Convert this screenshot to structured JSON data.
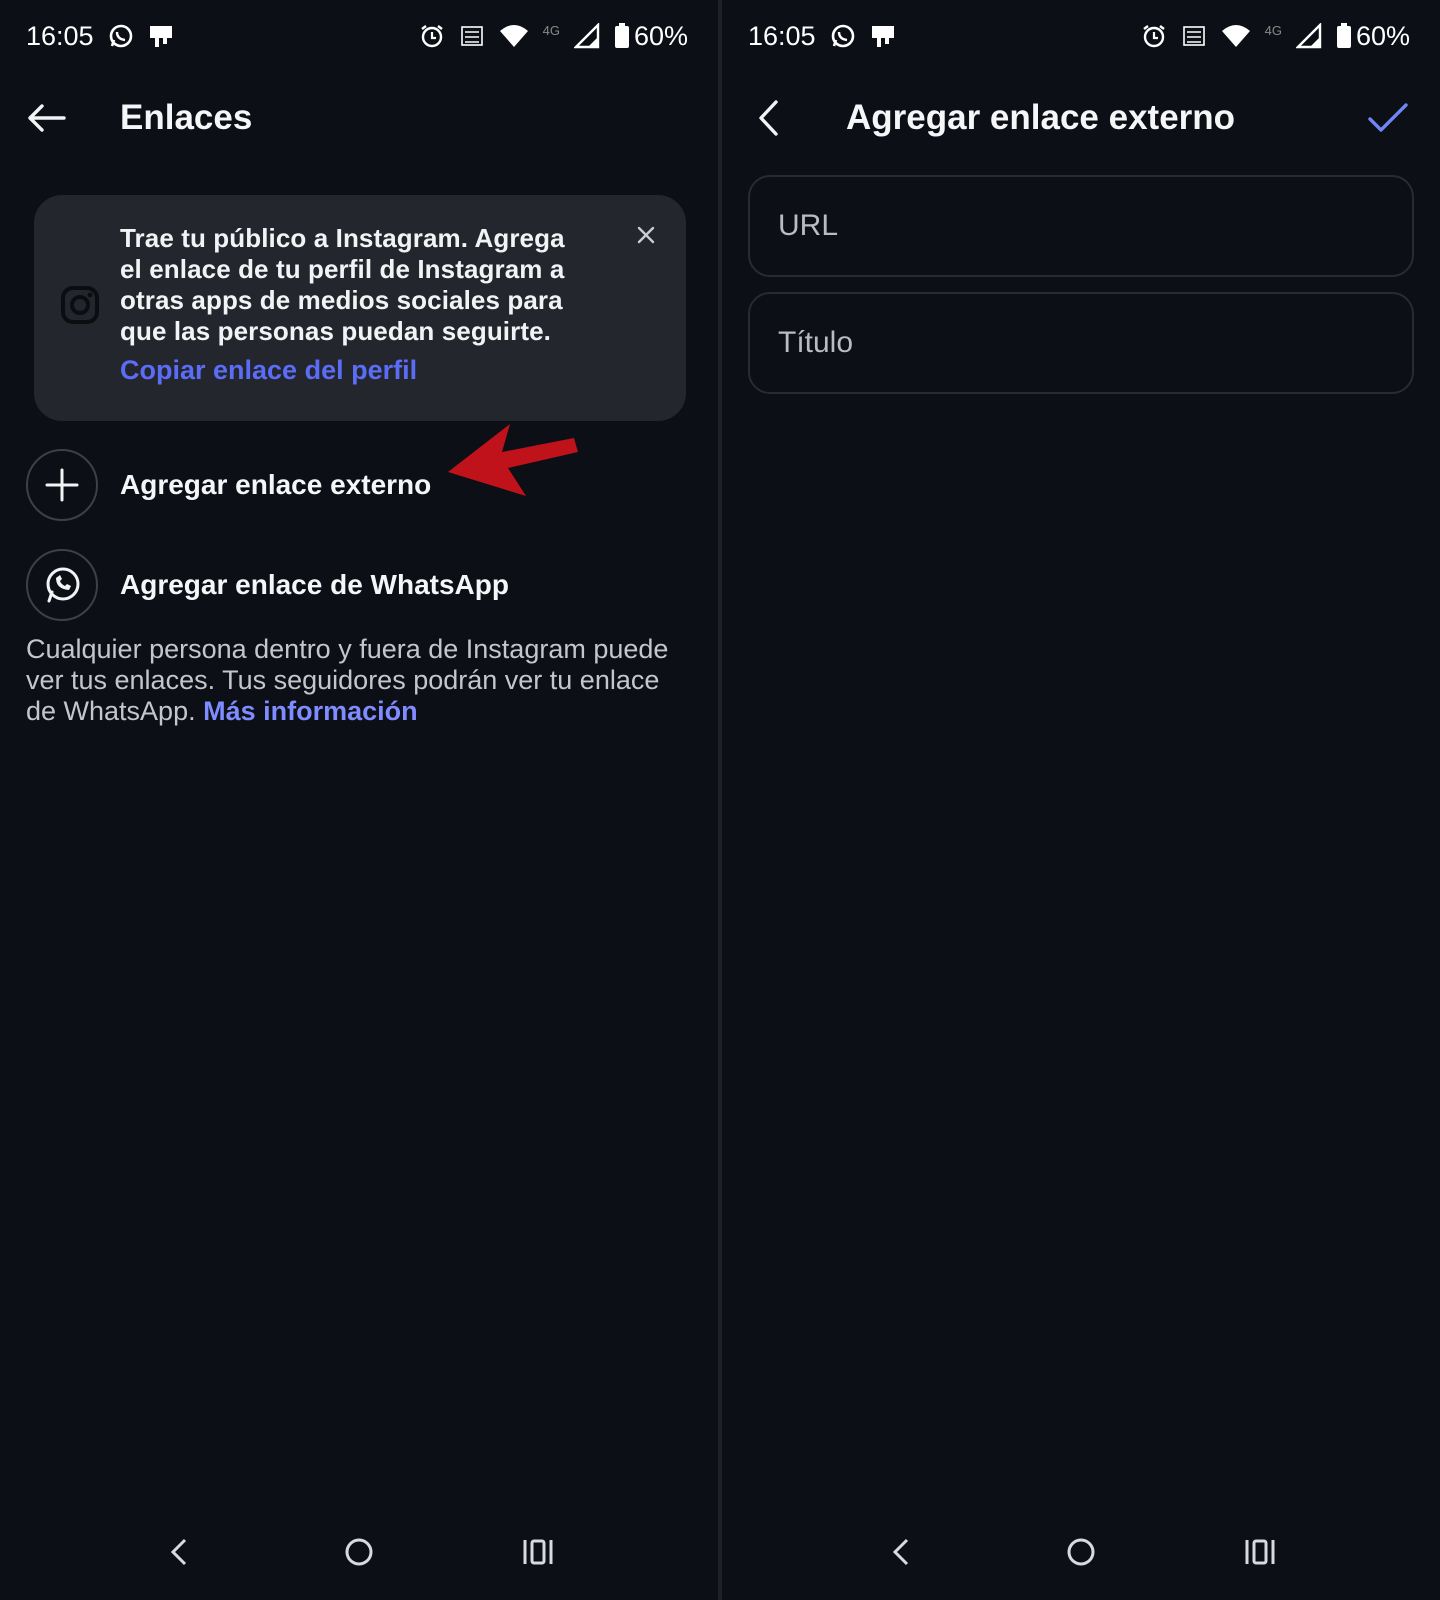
{
  "status_bar": {
    "time": "16:05",
    "battery": "60%",
    "network": "4G"
  },
  "left": {
    "title": "Enlaces",
    "promo": {
      "message": "Trae tu público a Instagram. Agrega el enlace de tu perfil de Instagram a otras apps de medios sociales para que las personas puedan seguirte.",
      "link": "Copiar enlace del perfil"
    },
    "items": [
      {
        "label": "Agregar enlace externo",
        "icon": "plus-icon"
      },
      {
        "label": "Agregar enlace de WhatsApp",
        "icon": "whatsapp-icon"
      }
    ],
    "info": {
      "text": "Cualquier persona dentro y fuera de Instagram puede ver tus enlaces. Tus seguidores podrán ver tu enlace de WhatsApp. ",
      "link": "Más información"
    }
  },
  "right": {
    "title": "Agregar enlace externo",
    "fields": {
      "url_placeholder": "URL",
      "title_placeholder": "Título"
    }
  },
  "colors": {
    "background": "#0c0f15",
    "card": "#23262d",
    "link": "#5b6cf6",
    "annotation_arrow": "#c0121b",
    "confirm": "#6f86f5"
  }
}
